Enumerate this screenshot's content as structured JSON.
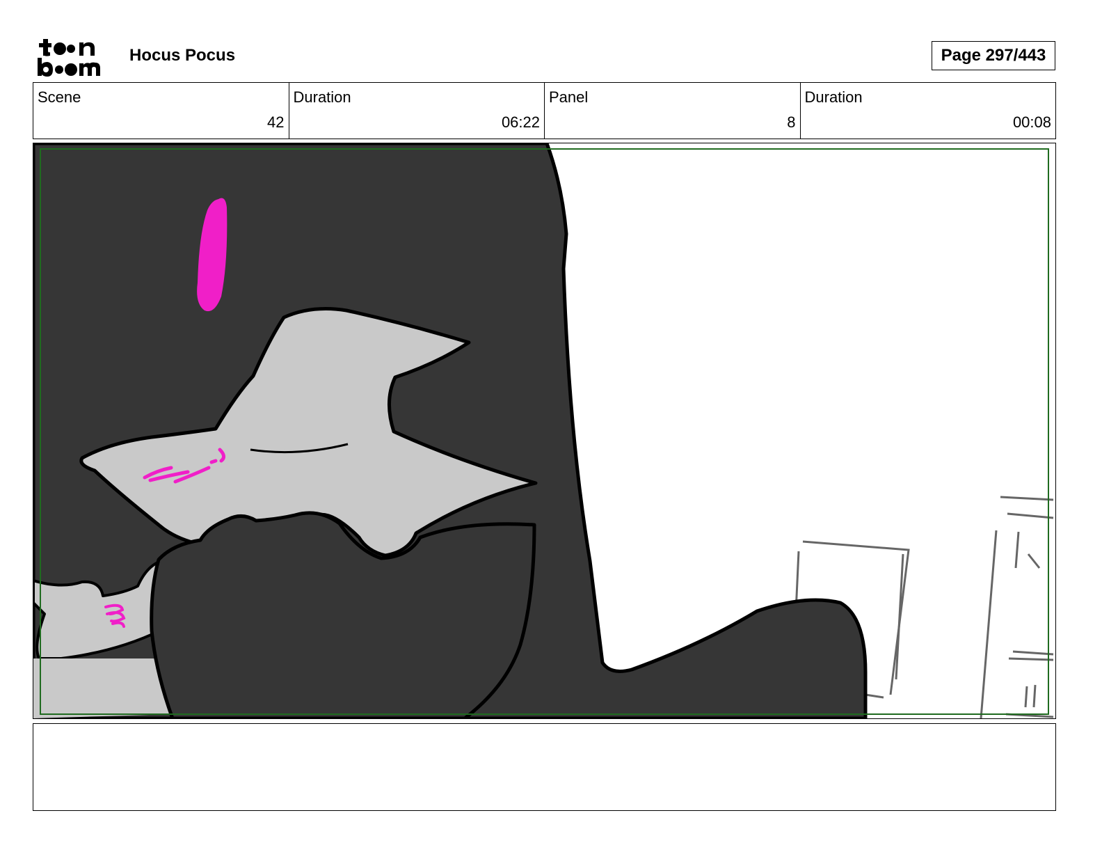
{
  "header": {
    "logo_text": "toon boom",
    "project_title": "Hocus Pocus",
    "page_label": "Page 297/443"
  },
  "info": [
    {
      "label": "Scene",
      "value": "42"
    },
    {
      "label": "Duration",
      "value": "06:22"
    },
    {
      "label": "Panel",
      "value": "8"
    },
    {
      "label": "Duration",
      "value": "00:08"
    }
  ],
  "panel": {
    "safe_frame_color": "#1f6b1f",
    "background_color": "#363636",
    "accent_color": "#f01fc8"
  },
  "notes": {
    "text": ""
  }
}
